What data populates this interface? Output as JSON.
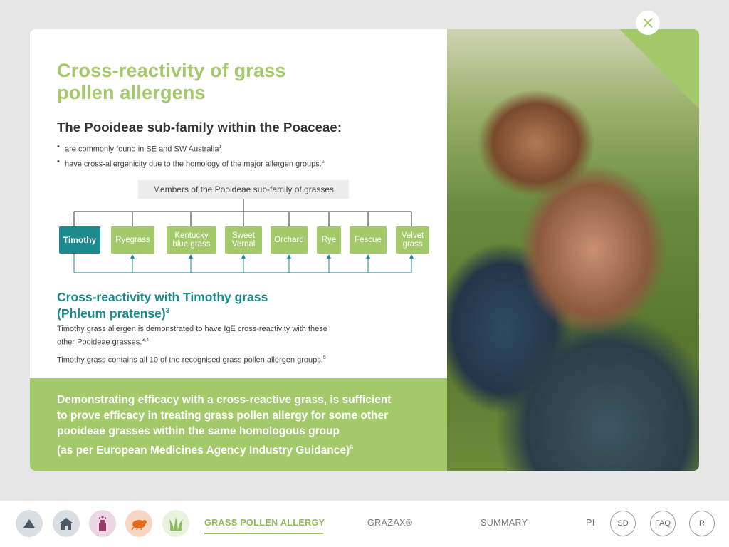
{
  "card": {
    "title_line1": "Cross-reactivity of grass",
    "title_line2": "pollen allergens",
    "subtitle": "The Pooideae sub-family within the Poaceae:",
    "bullets": [
      {
        "text": "are commonly found in SE and SW Australia",
        "ref": "1"
      },
      {
        "text": "have cross-allergenicity due to the homology of the major allergen groups.",
        "ref": "2"
      }
    ],
    "diagram_title": "Members of the Pooideae sub-family of grasses",
    "grasses": [
      {
        "line1": "Timothy",
        "line2": ""
      },
      {
        "line1": "Ryegrass",
        "line2": ""
      },
      {
        "line1": "Kentucky",
        "line2": "blue grass"
      },
      {
        "line1": "Sweet",
        "line2": "Vernal"
      },
      {
        "line1": "Orchard",
        "line2": ""
      },
      {
        "line1": "Rye",
        "line2": ""
      },
      {
        "line1": "Fescue",
        "line2": ""
      },
      {
        "line1": "Velvet",
        "line2": "grass"
      }
    ],
    "section2_line1": "Cross-reactivity with Timothy grass",
    "section2_line2": "(Phleum pratense)",
    "section2_ref": "3",
    "para1_line1": "Timothy grass allergen is demonstrated to have IgE cross-reactivity with these",
    "para1_line2": "other Pooideae grasses.",
    "para1_ref": "3,4",
    "para2": "Timothy grass contains all 10 of the recognised grass pollen allergen groups.",
    "para2_ref": "5",
    "banner_line1": "Demonstrating efficacy with a cross-reactive grass, is sufficient",
    "banner_line2": "to prove efficacy in treating grass pollen allergy for some other",
    "banner_line3": "pooideae grasses within the same homologous group",
    "banner_line4": "(as per European Medicines Agency Industry Guidance)",
    "banner_ref": "6"
  },
  "nav": {
    "icons": [
      "triangle-up-icon",
      "home-icon",
      "bottle-icon",
      "dust-mite-icon",
      "grass-icon"
    ],
    "tabs": [
      "GRASS POLLEN ALLERGY",
      "GRAZAX®",
      "SUMMARY",
      "PI"
    ],
    "circle_buttons": [
      "SD",
      "FAQ",
      "R"
    ]
  },
  "colors": {
    "accent_green": "#a3c96b",
    "teal": "#1a8a8f"
  }
}
